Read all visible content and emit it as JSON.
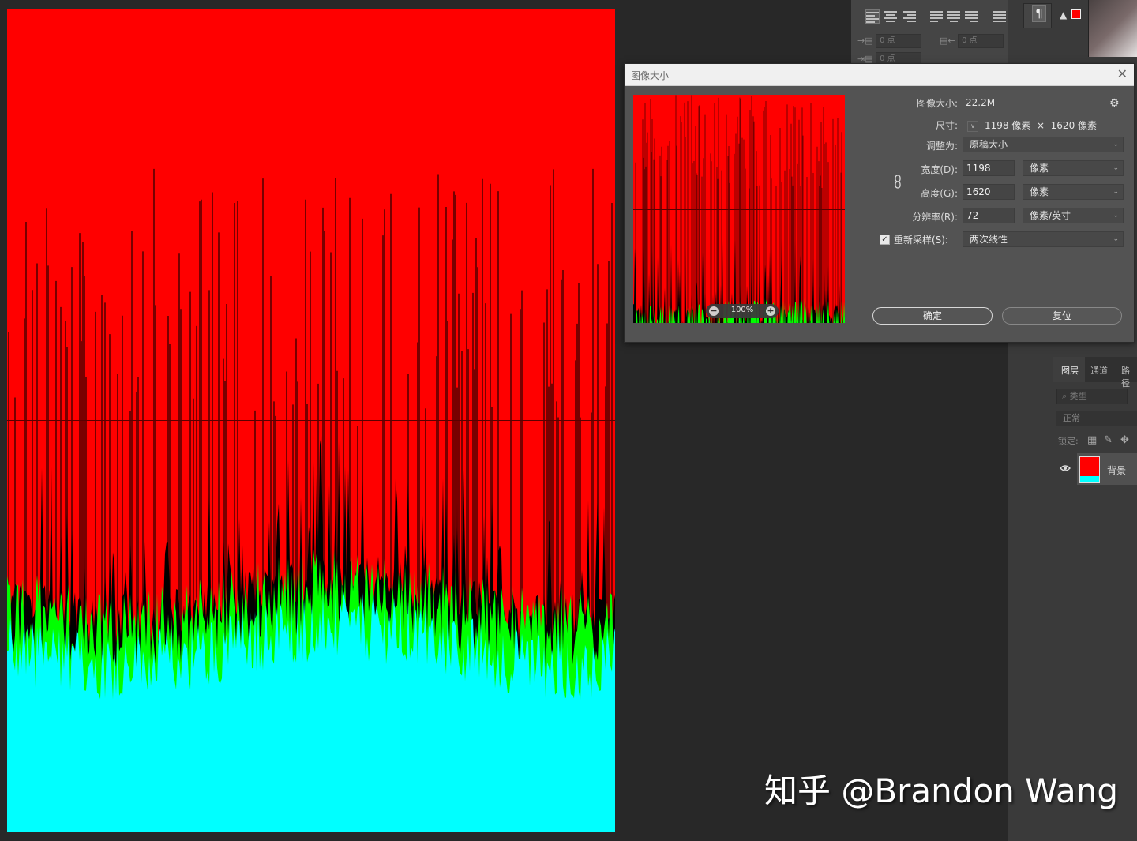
{
  "dialog": {
    "title": "图像大小",
    "image_size_label": "图像大小:",
    "image_size_value": "22.2M",
    "dimensions_label": "尺寸:",
    "dimensions_value": "1198 像素  ×  1620 像素",
    "fit_to_label": "调整为:",
    "fit_to_value": "原稿大小",
    "width_label": "宽度(D):",
    "width_value": "1198",
    "width_unit": "像素",
    "height_label": "高度(G):",
    "height_value": "1620",
    "height_unit": "像素",
    "resolution_label": "分辨率(R):",
    "resolution_value": "72",
    "resolution_unit": "像素/英寸",
    "resample_label": "重新采样(S):",
    "resample_checked": true,
    "resample_value": "两次线性",
    "zoom_level": "100%",
    "ok_label": "确定",
    "reset_label": "复位"
  },
  "paragraph_panel": {
    "indent_left_value": "0 点",
    "indent_right_value": "0 点",
    "first_line_value": "0 点"
  },
  "layers_panel": {
    "tabs": [
      "图层",
      "通道",
      "路径"
    ],
    "filter_placeholder": "类型",
    "blend_mode": "正常",
    "lock_label": "锁定:",
    "layer_name": "背景"
  },
  "colors": {
    "canvas_top": "#ff0000",
    "canvas_bottom": "#00ffff",
    "edge": "#00ff00",
    "workspace": "#282828",
    "dialog_bg": "#535353"
  },
  "icons": [
    "gear-icon",
    "link-icon",
    "eye-icon",
    "zoom-in-icon",
    "zoom-out-icon",
    "close-icon",
    "pilcrow-icon",
    "warning-icon"
  ],
  "watermark": "知乎 @Brandon Wang"
}
